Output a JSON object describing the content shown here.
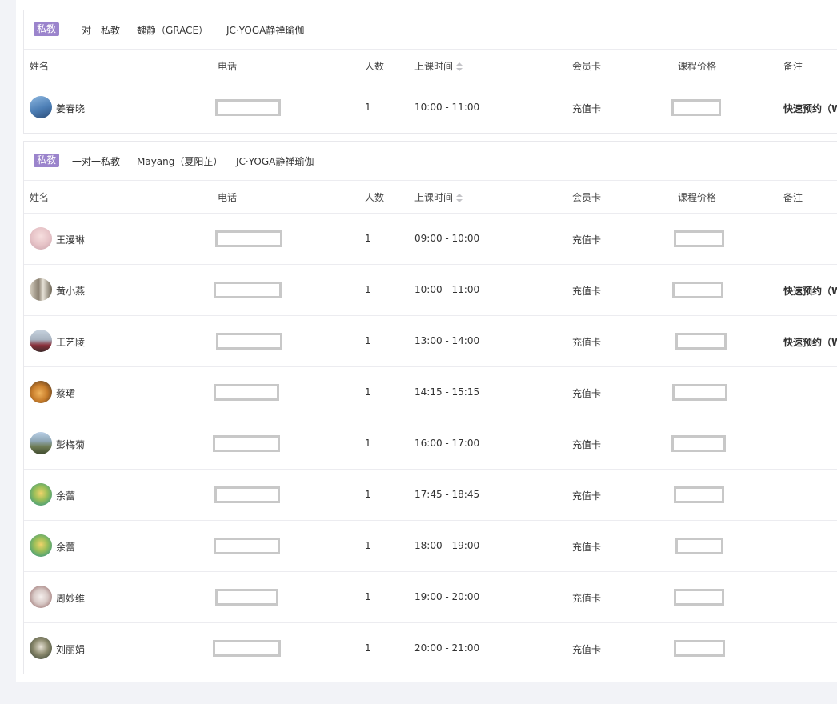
{
  "columns": [
    "姓名",
    "电话",
    "人数",
    "上课时间",
    "会员卡",
    "课程价格",
    "备注"
  ],
  "cards": [
    {
      "badge": "私教",
      "type": "一对一私教",
      "coach": "魏静（GRACE）",
      "venue": "JC·YOGA静禅瑜伽",
      "rows": [
        {
          "name": "姜春晓",
          "count": "1",
          "time": "10:00 - 11:00",
          "card": "充值卡",
          "note": "快速预约（W"
        }
      ]
    },
    {
      "badge": "私教",
      "type": "一对一私教",
      "coach": "Mayang（夏阳芷）",
      "venue": "JC·YOGA静禅瑜伽",
      "rows": [
        {
          "name": "王漫琳",
          "count": "1",
          "time": "09:00 - 10:00",
          "card": "充值卡",
          "note": ""
        },
        {
          "name": "黄小燕",
          "count": "1",
          "time": "10:00 - 11:00",
          "card": "充值卡",
          "note": "快速预约（W"
        },
        {
          "name": "王艺陵",
          "count": "1",
          "time": "13:00 - 14:00",
          "card": "充值卡",
          "note": "快速预约（W"
        },
        {
          "name": "蔡珺",
          "count": "1",
          "time": "14:15 - 15:15",
          "card": "充值卡",
          "note": ""
        },
        {
          "name": "彭梅菊",
          "count": "1",
          "time": "16:00 - 17:00",
          "card": "充值卡",
          "note": ""
        },
        {
          "name": "余蕾",
          "count": "1",
          "time": "17:45 - 18:45",
          "card": "充值卡",
          "note": ""
        },
        {
          "name": "余蕾",
          "count": "1",
          "time": "18:00 - 19:00",
          "card": "充值卡",
          "note": ""
        },
        {
          "name": "周妙维",
          "count": "1",
          "time": "19:00 - 20:00",
          "card": "充值卡",
          "note": ""
        },
        {
          "name": "刘丽娟",
          "count": "1",
          "time": "20:00 - 21:00",
          "card": "充值卡",
          "note": ""
        }
      ]
    }
  ],
  "colors": {
    "badge": "#9b84cc",
    "mask": "#c8c8c8",
    "border": "#e8e8ec"
  }
}
